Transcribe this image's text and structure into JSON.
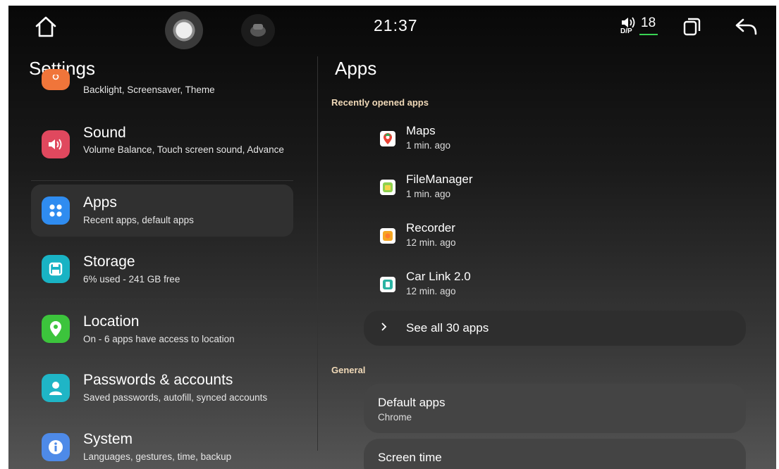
{
  "status_bar": {
    "time": "21:37",
    "volume_sub": "D/P",
    "volume_level": "18"
  },
  "left": {
    "title": "Settings",
    "display_subtitle": "Backlight, Screensaver, Theme",
    "items": [
      {
        "title": "Sound",
        "subtitle": "Volume Balance, Touch screen sound, Advance",
        "color": "#e0485e"
      },
      {
        "title": "Apps",
        "subtitle": "Recent apps, default apps",
        "color": "#2f8cf0",
        "selected": true
      },
      {
        "title": "Storage",
        "subtitle": "6% used - 241 GB free",
        "color": "#19b3c4"
      },
      {
        "title": "Location",
        "subtitle": "On - 6 apps have access to location",
        "color": "#3cc43c"
      },
      {
        "title": "Passwords & accounts",
        "subtitle": "Saved passwords, autofill, synced accounts",
        "color": "#1fb5c6"
      },
      {
        "title": "System",
        "subtitle": "Languages, gestures, time, backup",
        "color": "#4e8ae8"
      }
    ],
    "display_color": "#f0753a"
  },
  "right": {
    "title": "Apps",
    "recent_header": "Recently opened apps",
    "recent_apps": [
      {
        "name": "Maps",
        "when": "1 min. ago",
        "icon": "maps-icon"
      },
      {
        "name": "FileManager",
        "when": "1 min. ago",
        "icon": "file-manager-icon"
      },
      {
        "name": "Recorder",
        "when": "12 min. ago",
        "icon": "recorder-icon"
      },
      {
        "name": "Car Link 2.0",
        "when": "12 min. ago",
        "icon": "car-link-icon"
      }
    ],
    "see_all": "See all 30 apps",
    "general_header": "General",
    "default_apps": {
      "title": "Default apps",
      "subtitle": "Chrome"
    },
    "screen_time": {
      "title": "Screen time"
    }
  }
}
